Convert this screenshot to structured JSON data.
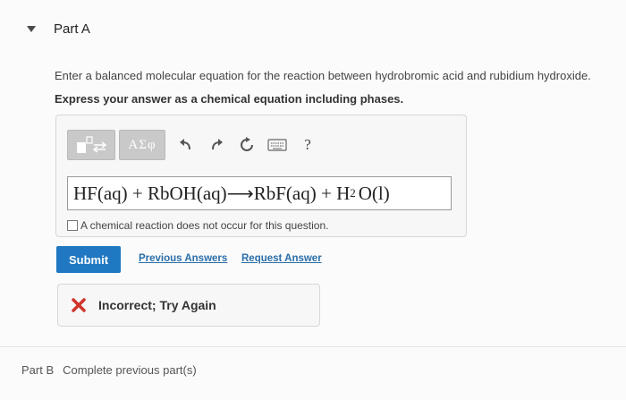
{
  "part_a": {
    "title": "Part A",
    "prompt": "Enter a balanced molecular equation for the reaction between hydrobromic acid and rubidium hydroxide.",
    "instruction": "Express your answer as a chemical equation including phases.",
    "toolbar": {
      "greek_label": "ΑΣφ",
      "help_label": "?",
      "icons": [
        "template-icon",
        "undo-icon",
        "redo-icon",
        "reset-icon",
        "keyboard-icon"
      ]
    },
    "equation": {
      "lhs": "HF(aq) + RbOH(aq)",
      "arrow": "⟶",
      "rhs_main": "RbF(aq) + H",
      "rhs_sub": "2",
      "rhs_tail": "O(l)"
    },
    "no_reaction_checkbox": {
      "label": "A chemical reaction does not occur for this question.",
      "checked": false
    },
    "submit_label": "Submit",
    "previous_answers_label": "Previous Answers",
    "request_answer_label": "Request Answer",
    "feedback": {
      "status": "incorrect",
      "text": "Incorrect; Try Again",
      "color": "#d0342c"
    }
  },
  "part_b": {
    "label": "Part B",
    "status": "Complete previous part(s)"
  },
  "colors": {
    "accent": "#1f78c1",
    "link": "#2a6ea8",
    "error": "#d0342c"
  }
}
